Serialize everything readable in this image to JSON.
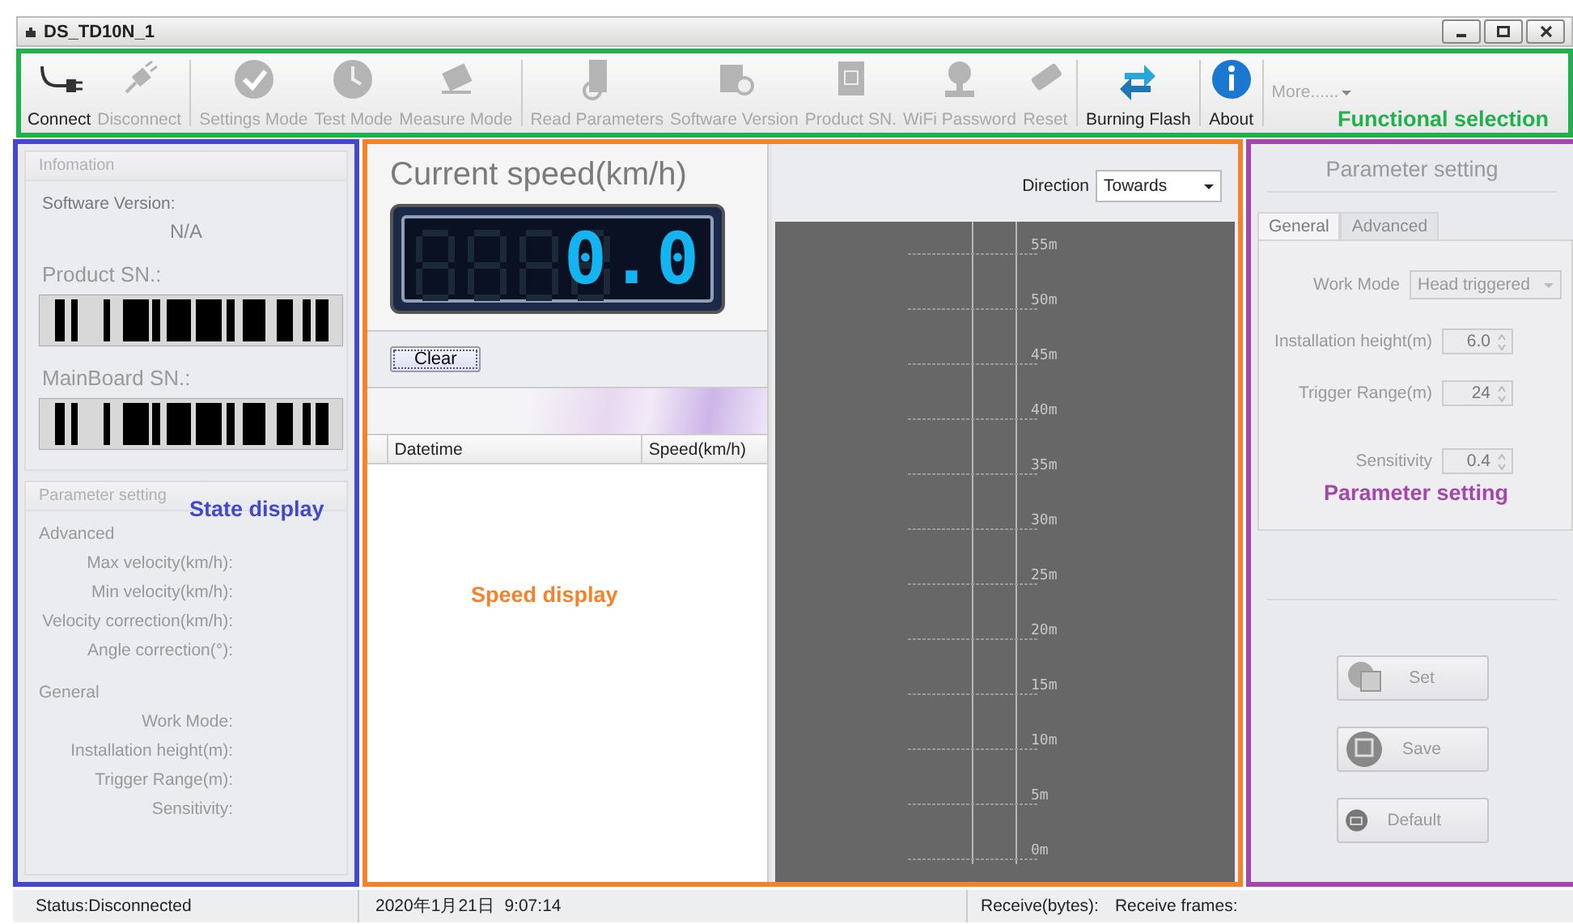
{
  "window": {
    "title": "DS_TD10N_1"
  },
  "toolbar": {
    "groups": [
      [
        {
          "label": "Connect",
          "disabled": false
        },
        {
          "label": "Disconnect",
          "disabled": true
        }
      ],
      [
        {
          "label": "Settings Mode",
          "disabled": true
        },
        {
          "label": "Test Mode",
          "disabled": true
        },
        {
          "label": "Measure Mode",
          "disabled": true
        }
      ],
      [
        {
          "label": "Read Parameters",
          "disabled": true
        },
        {
          "label": "Software Version",
          "disabled": true
        },
        {
          "label": "Product SN.",
          "disabled": true
        },
        {
          "label": "WiFi Password",
          "disabled": true
        },
        {
          "label": "Reset",
          "disabled": true
        }
      ],
      [
        {
          "label": "Burning Flash",
          "disabled": false
        }
      ],
      [
        {
          "label": "About",
          "disabled": false
        }
      ]
    ],
    "more": "More......",
    "annotation": {
      "label": "Functional selection",
      "color": "#21b04b"
    }
  },
  "state_panel": {
    "annotation": {
      "label": "State display",
      "color": "#4349c9"
    },
    "info_group": {
      "title": "Infomation",
      "software_version_label": "Software Version:",
      "software_version": "N/A",
      "product_sn_label": "Product SN.:",
      "mainboard_sn_label": "MainBoard SN.:"
    },
    "parameter_group": {
      "title": "Parameter setting",
      "rows": [
        {
          "kind": "section",
          "label": "Advanced"
        },
        {
          "kind": "field",
          "label": "Max velocity(km/h):"
        },
        {
          "kind": "field",
          "label": "Min velocity(km/h):"
        },
        {
          "kind": "field",
          "label": "Velocity correction(km/h):"
        },
        {
          "kind": "field",
          "label": "Angle correction(°):"
        },
        {
          "kind": "section",
          "label": "General"
        },
        {
          "kind": "field",
          "label": "Work Mode:"
        },
        {
          "kind": "field",
          "label": "Installation height(m):"
        },
        {
          "kind": "field",
          "label": "Trigger Range(m):"
        },
        {
          "kind": "field",
          "label": "Sensitivity:"
        }
      ]
    }
  },
  "speed_panel": {
    "annotation": {
      "label": "Speed display",
      "color": "#f5822a"
    },
    "heading": "Current speed(km/h)",
    "speed": "0.0",
    "clear_button": "Clear",
    "table": {
      "columns": [
        "Datetime",
        "Speed(km/h)"
      ]
    },
    "direction": {
      "label": "Direction",
      "value": "Towards"
    },
    "distance_marks": [
      "55m",
      "50m",
      "45m",
      "40m",
      "35m",
      "30m",
      "25m",
      "20m",
      "15m",
      "10m",
      "5m",
      "0m"
    ]
  },
  "parameter_panel": {
    "annotation": {
      "label": "Parameter setting",
      "color": "#a447ad"
    },
    "title": "Parameter setting",
    "tabs": [
      {
        "label": "General",
        "selected": true
      },
      {
        "label": "Advanced",
        "selected": false
      }
    ],
    "fields": [
      {
        "kind": "dropdown",
        "label": "Work Mode",
        "value": "Head triggered"
      },
      {
        "kind": "spinner",
        "label": "Installation height(m)",
        "value": "6.0"
      },
      {
        "kind": "spinner",
        "label": "Trigger Range(m)",
        "value": "24"
      },
      {
        "kind": "spinner",
        "label": "Sensitivity",
        "value": "0.4"
      }
    ],
    "buttons": [
      {
        "label": "Set",
        "disabled": true
      },
      {
        "label": "Save",
        "disabled": true
      },
      {
        "label": "Default",
        "disabled": true
      }
    ]
  },
  "status_bar": {
    "status": "Status:Disconnected",
    "datetime": "2020年1月21日  9:07:14",
    "receive_bytes": "Receive(bytes):",
    "receive_frames": "Receive frames:"
  }
}
